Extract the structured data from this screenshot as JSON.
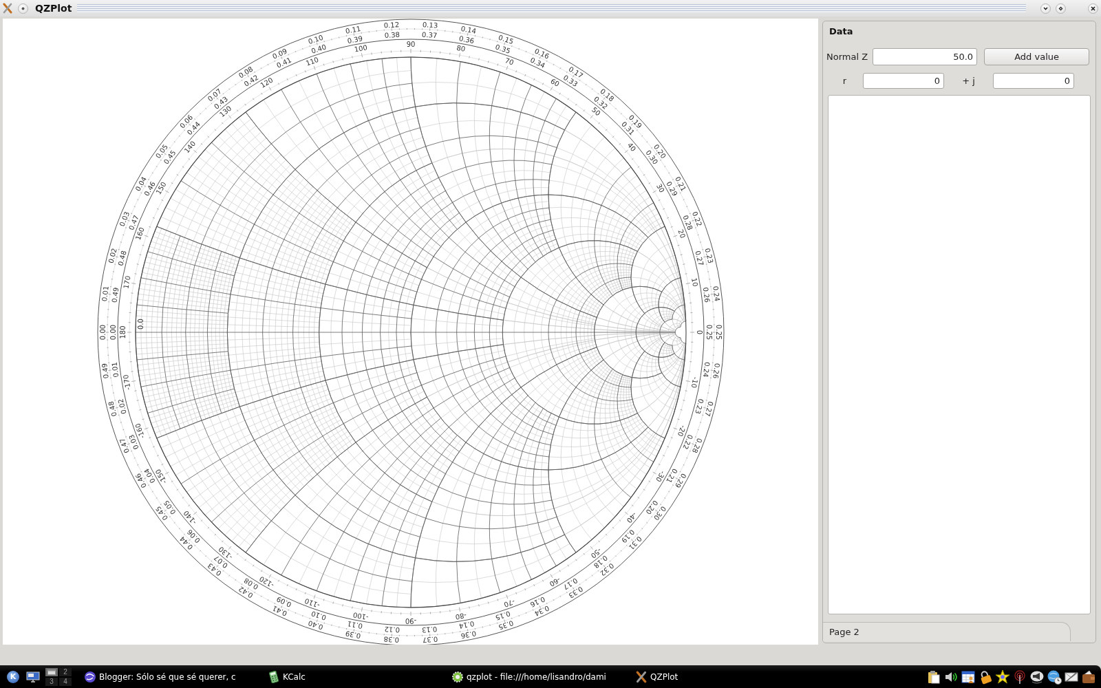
{
  "window": {
    "title": "QZPlot"
  },
  "smith_chart": {
    "wavelengths_toward_generator": [
      "0.00",
      "0.01",
      "0.02",
      "0.03",
      "0.04",
      "0.05",
      "0.06",
      "0.07",
      "0.08",
      "0.09",
      "0.10",
      "0.11",
      "0.12",
      "0.13",
      "0.14",
      "0.15",
      "0.16",
      "0.17",
      "0.18",
      "0.19",
      "0.20",
      "0.21",
      "0.22",
      "0.23",
      "0.24",
      "0.25",
      "0.26",
      "0.27",
      "0.28",
      "0.29",
      "0.30",
      "0.31",
      "0.32",
      "0.33",
      "0.34",
      "0.35",
      "0.36",
      "0.37",
      "0.38",
      "0.39",
      "0.40",
      "0.41",
      "0.42",
      "0.43",
      "0.44",
      "0.45",
      "0.46",
      "0.47",
      "0.48",
      "0.49"
    ],
    "wavelengths_toward_load": [
      "0.00",
      "0.49",
      "0.48",
      "0.47",
      "0.46",
      "0.45",
      "0.44",
      "0.43",
      "0.42",
      "0.41",
      "0.40",
      "0.39",
      "0.38",
      "0.37",
      "0.36",
      "0.35",
      "0.34",
      "0.33",
      "0.32",
      "0.31",
      "0.30",
      "0.29",
      "0.28",
      "0.27",
      "0.26",
      "0.25",
      "0.24",
      "0.23",
      "0.22",
      "0.21",
      "0.20",
      "0.19",
      "0.18",
      "0.17",
      "0.16",
      "0.15",
      "0.14",
      "0.13",
      "0.12",
      "0.11",
      "0.10",
      "0.09",
      "0.08",
      "0.07",
      "0.06",
      "0.05",
      "0.04",
      "0.03",
      "0.02",
      "0.01"
    ],
    "angle_labels": [
      "180",
      "170",
      "160",
      "150",
      "140",
      "130",
      "120",
      "110",
      "100",
      "90",
      "80",
      "70",
      "60",
      "50",
      "40",
      "30",
      "20",
      "10",
      "0",
      "-10",
      "-20",
      "-30",
      "-40",
      "-50",
      "-60",
      "-70",
      "-80",
      "-90",
      "-100",
      "-110",
      "-120",
      "-130",
      "-140",
      "-150",
      "-160",
      "-170"
    ],
    "axis_label": "0.0"
  },
  "dock": {
    "title": "Data",
    "normal_z": {
      "label": "Normal Z",
      "value": "50.0"
    },
    "add_button": "Add value",
    "r": {
      "label": "r",
      "value": "0"
    },
    "j": {
      "label": "+ j",
      "value": "0"
    },
    "tabs": [
      {
        "label": "Page 2",
        "selected": true
      }
    ]
  },
  "taskbar": {
    "start_label": "K",
    "pager": [
      {
        "selected": true
      },
      {
        "label": "2",
        "selected": false
      },
      {
        "label": "3",
        "selected": false
      },
      {
        "label": "4",
        "selected": false
      }
    ],
    "tasks": [
      {
        "label": "Blogger: Sólo sé que sé querer, c",
        "kind": "browser"
      },
      {
        "label": "KCalc",
        "kind": "calculator"
      },
      {
        "label": "qzplot - file:///home/lisandro/dami",
        "kind": "viewer"
      },
      {
        "label": "QZPlot",
        "kind": "plotter"
      }
    ]
  }
}
